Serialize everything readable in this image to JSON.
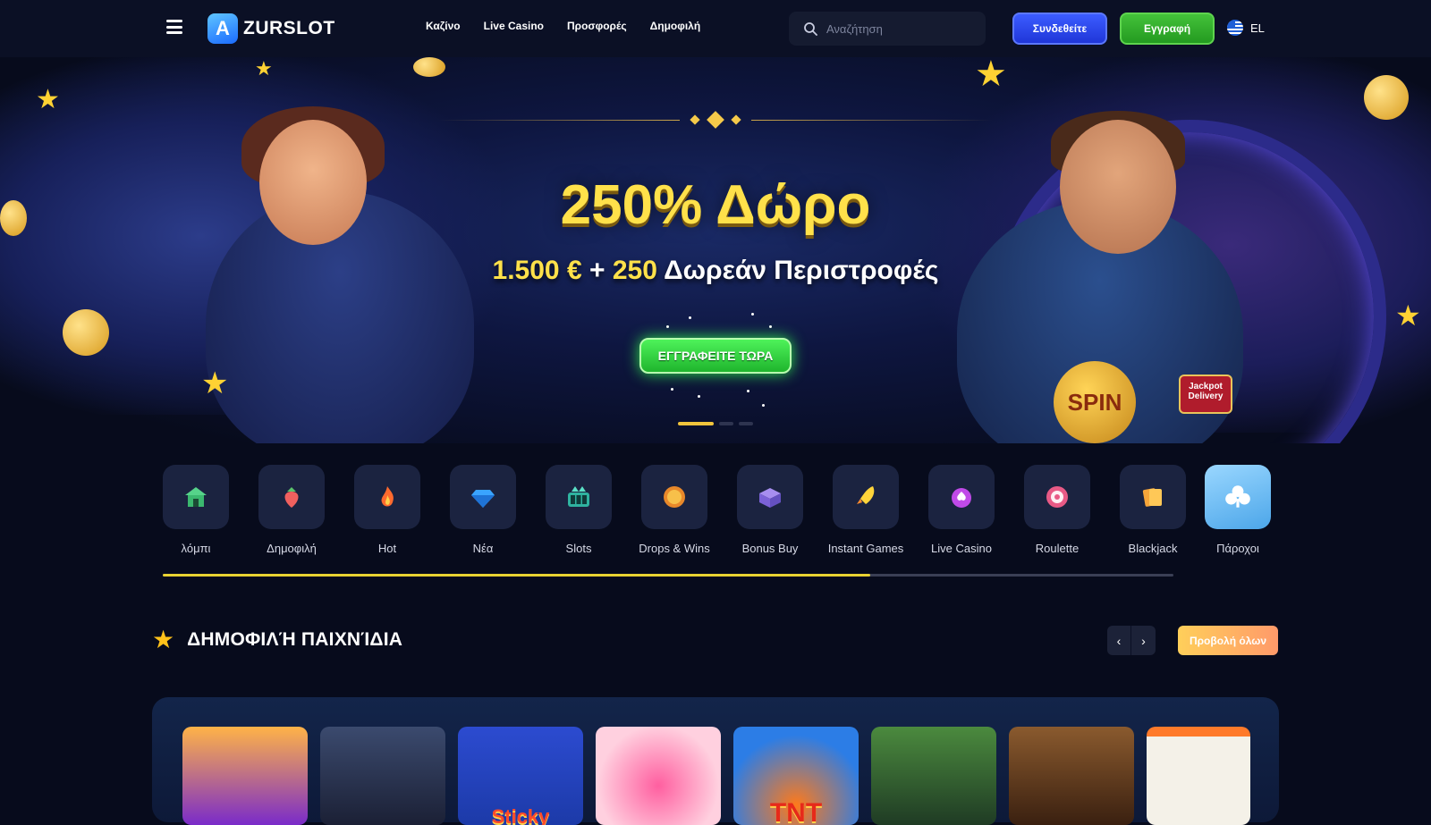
{
  "header": {
    "logo_letter": "A",
    "logo_text": "ZURSLOT",
    "nav": [
      "Καζίνο",
      "Live Casino",
      "Προσφορές",
      "Δημοφιλή"
    ],
    "search_placeholder": "Αναζήτηση",
    "login_label": "Συνδεθείτε",
    "register_label": "Εγγραφή",
    "language": "EL"
  },
  "hero": {
    "title": "250% Δώρο",
    "subtitle_amount": "1.500 €",
    "subtitle_plus": " + ",
    "subtitle_spins": "250",
    "subtitle_rest": " Δωρεάν Περιστροφές",
    "cta_label": "ΕΓΓΡΑΦΕΙΤΕ ΤΩΡΑ",
    "badge_spin": "SPIN",
    "badge_jackpot": "Jackpot Delivery",
    "slides": 3,
    "active_slide": 1
  },
  "categories": [
    {
      "label": "λόμπι",
      "icon": "lobby-icon"
    },
    {
      "label": "Δημοφιλή",
      "icon": "strawberry-icon"
    },
    {
      "label": "Hot",
      "icon": "flame-icon"
    },
    {
      "label": "Νέα",
      "icon": "diamond-icon"
    },
    {
      "label": "Slots",
      "icon": "slot-machine-icon"
    },
    {
      "label": "Drops & Wins",
      "icon": "drops-wins-icon"
    },
    {
      "label": "Bonus Buy",
      "icon": "bonus-box-icon"
    },
    {
      "label": "Instant Games",
      "icon": "rocket-icon"
    },
    {
      "label": "Live Casino",
      "icon": "spade-chip-icon"
    },
    {
      "label": "Roulette",
      "icon": "roulette-icon"
    },
    {
      "label": "Blackjack",
      "icon": "cards-icon"
    },
    {
      "label": "Πάροχοι",
      "icon": "club-icon"
    }
  ],
  "category_scroll_progress": 0.7,
  "popular": {
    "title": "ΔΗΜΟΦΙΛΉ ΠΑΙΧΝΊΔΙΑ",
    "view_all_label": "Προβολή όλων",
    "games": [
      {
        "name": "",
        "color": "#7a2bc9"
      },
      {
        "name": "",
        "color": "#26304f"
      },
      {
        "name": "Sticky",
        "color": "#1c3aa8"
      },
      {
        "name": "",
        "color": "#ffb1c8"
      },
      {
        "name": "TNT",
        "color": "#2c7de6"
      },
      {
        "name": "",
        "color": "#2f6b3a"
      },
      {
        "name": "",
        "color": "#6a3a1e"
      },
      {
        "name": "",
        "color": "#f4f1e8"
      }
    ]
  },
  "colors": {
    "accent_yellow": "#ffe14a",
    "login_blue": "#2f48ec",
    "register_green": "#35b02e",
    "background": "#070b1c"
  }
}
